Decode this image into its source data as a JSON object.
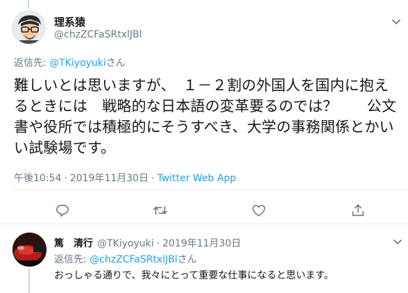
{
  "main_tweet": {
    "author_name": "理系猿",
    "author_handle": "@chzZCFaSRtxlJBl",
    "reply_to_prefix": "返信先: ",
    "reply_to_handle": "@TKiyoyuki",
    "reply_to_suffix": "さん",
    "body": "難しいとは思いますが、　１－２割の外国人を国内に抱えるときには　戦略的な日本語の変革要るのでは？　　公文書や役所では積極的にそうすべき、大学の事務関係とかいい試験場です。",
    "time": "午後10:54",
    "date": "2019年11月30日",
    "app": "Twitter Web App",
    "actions": {
      "reply_icon": "reply-icon",
      "retweet_icon": "retweet-icon",
      "like_icon": "heart-icon",
      "share_icon": "share-icon"
    }
  },
  "reply_tweet": {
    "author_name": "篤　清行",
    "author_handle": "@TKiyoyuki",
    "date": "2019年11月30日",
    "reply_to_prefix": "返信先: ",
    "reply_to_handle": "@chzZCFaSRtxlJBl",
    "reply_to_suffix": "さん",
    "body": "おっしゃる通りで、我々にとって重要な仕事になると思います。"
  },
  "colors": {
    "link": "#1da1f2",
    "secondary": "#657786",
    "text": "#14171a",
    "divider": "#e6ecf0"
  }
}
